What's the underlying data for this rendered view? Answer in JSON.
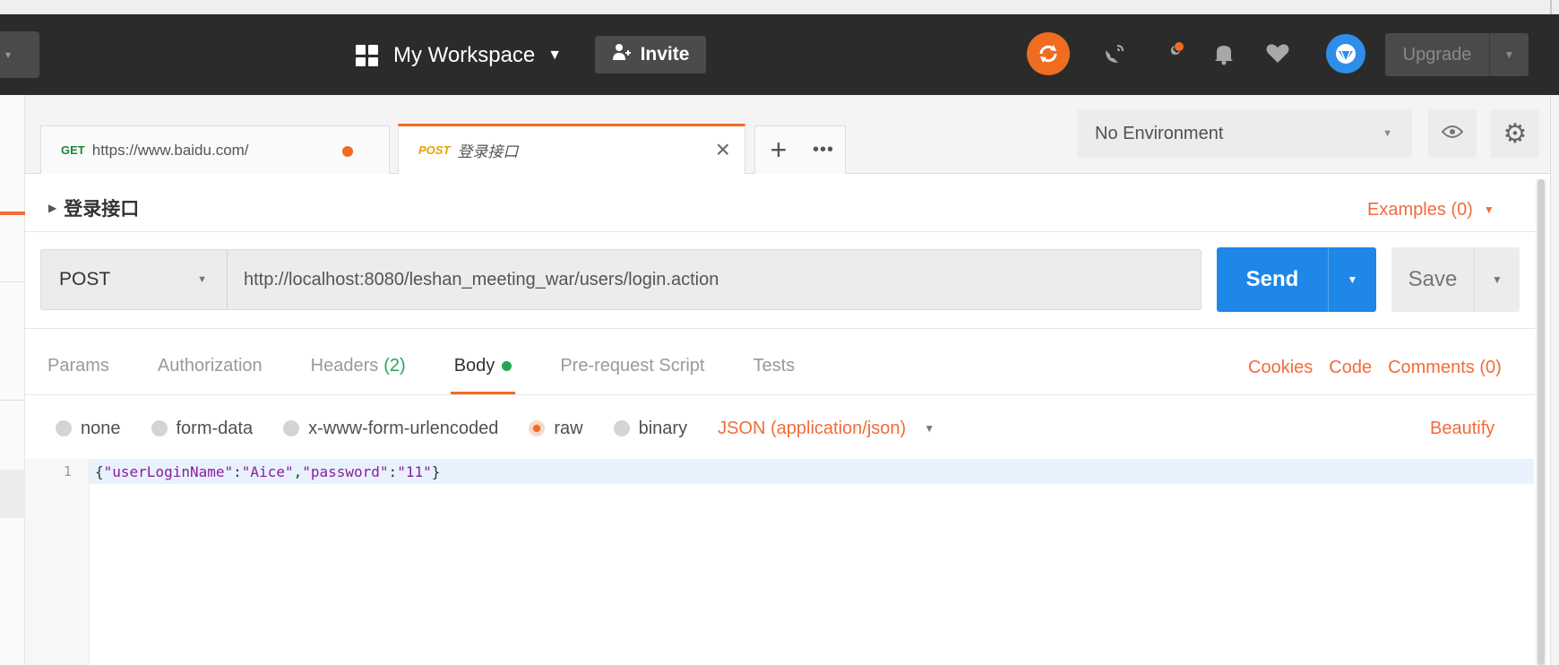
{
  "header": {
    "workspace_label": "My Workspace",
    "invite_label": "Invite",
    "upgrade_label": "Upgrade",
    "icons": [
      "sync-icon",
      "satellite-icon",
      "wrench-icon",
      "bell-icon",
      "heart-icon",
      "avatar-icon"
    ],
    "colors": {
      "bar": "#2b2b2b",
      "sync": "#ef6c21",
      "avatar": "#2e8ee8"
    }
  },
  "tabs": [
    {
      "method": "GET",
      "name": "https://www.baidu.com/",
      "unsaved": true
    },
    {
      "method": "POST",
      "name": "登录接口",
      "active": true
    }
  ],
  "new_tab": {
    "plus": "+",
    "more": "•••"
  },
  "environment": {
    "selected": "No Environment"
  },
  "request": {
    "name": "登录接口",
    "examples_label": "Examples (0)",
    "method": "POST",
    "url": "http://localhost:8080/leshan_meeting_war/users/login.action",
    "send_label": "Send",
    "save_label": "Save"
  },
  "subtabs": {
    "params": "Params",
    "authorization": "Authorization",
    "headers": "Headers",
    "headers_count": "(2)",
    "body": "Body",
    "prerequest": "Pre-request Script",
    "tests": "Tests"
  },
  "right_links": {
    "cookies": "Cookies",
    "code": "Code",
    "comments": "Comments (0)"
  },
  "body_types": {
    "none": "none",
    "form_data": "form-data",
    "urlencoded": "x-www-form-urlencoded",
    "raw": "raw",
    "binary": "binary",
    "selected": "raw",
    "format": "JSON (application/json)",
    "beautify": "Beautify"
  },
  "editor": {
    "line_number": "1",
    "tokens": {
      "open": "{",
      "k1": "\"userLoginName\"",
      "c1": ":",
      "v1": "\"Aice\"",
      "comma": ",",
      "k2": "\"password\"",
      "c2": ":",
      "v2": "\"11\"",
      "close": "}"
    }
  },
  "accent_colors": {
    "orange": "#ef6c21",
    "blue": "#1e87e8",
    "green": "#26a65b"
  }
}
